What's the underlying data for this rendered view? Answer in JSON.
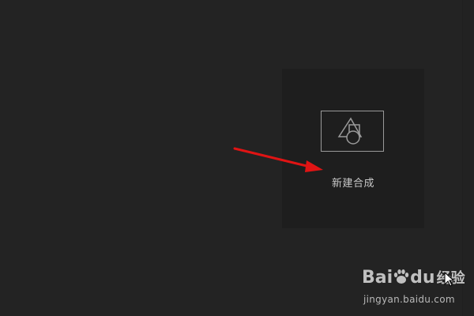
{
  "new_composition": {
    "label": "新建合成",
    "icon": "composition-shapes-icon"
  },
  "annotation": {
    "arrow_color": "#e01414"
  },
  "watermark": {
    "logo_text": "Bai",
    "logo_suffix": "du",
    "logo_cn": "经验",
    "url": "jingyan.baidu.com"
  },
  "colors": {
    "background": "#232323",
    "panel": "#1e1e1e",
    "icon_stroke": "#9a9a9a",
    "label": "#c8c8c8"
  }
}
